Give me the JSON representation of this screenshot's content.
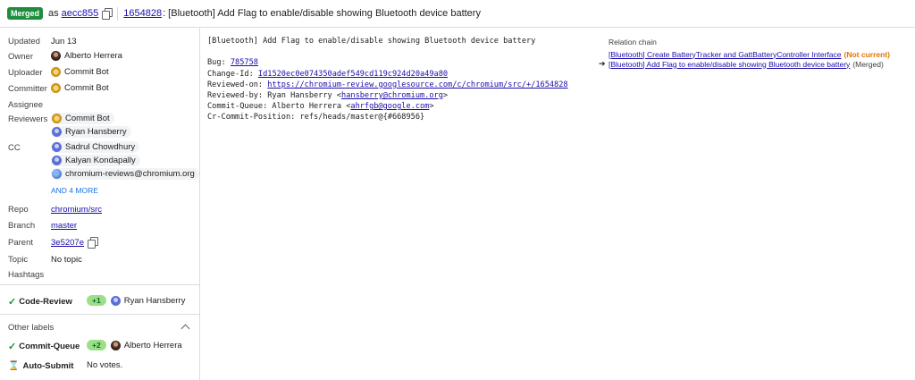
{
  "header": {
    "status_badge": "Merged",
    "as_text": "as",
    "commit_hash": "aecc855",
    "change_number": "1654828",
    "change_title": ": [Bluetooth] Add Flag to enable/disable showing Bluetooth device battery"
  },
  "sidebar": {
    "updated": {
      "label": "Updated",
      "value": "Jun 13"
    },
    "owner": {
      "label": "Owner",
      "name": "Alberto Herrera"
    },
    "uploader": {
      "label": "Uploader",
      "name": "Commit Bot"
    },
    "committer": {
      "label": "Committer",
      "name": "Commit Bot"
    },
    "assignee": {
      "label": "Assignee"
    },
    "reviewers": {
      "label": "Reviewers",
      "items": [
        "Commit Bot",
        "Ryan Hansberry"
      ]
    },
    "cc": {
      "label": "CC",
      "items": [
        "Sadrul Chowdhury",
        "Kalyan Kondapally",
        "chromium-reviews@chromium.org"
      ],
      "more": "AND 4 MORE"
    },
    "repo": {
      "label": "Repo",
      "value": "chromium/src"
    },
    "branch": {
      "label": "Branch",
      "value": "master"
    },
    "parent": {
      "label": "Parent",
      "value": "3e5207e"
    },
    "topic": {
      "label": "Topic",
      "value": "No topic"
    },
    "hashtags": {
      "label": "Hashtags"
    }
  },
  "labels": {
    "code_review": {
      "label": "Code-Review",
      "vote": "+1",
      "voter": "Ryan Hansberry"
    },
    "other_labels_title": "Other labels",
    "commit_queue": {
      "label": "Commit-Queue",
      "vote": "+2",
      "voter": "Alberto Herrera"
    },
    "auto_submit": {
      "label": "Auto-Submit",
      "value": "No votes."
    }
  },
  "commit_message": {
    "title": "[Bluetooth] Add Flag to enable/disable showing Bluetooth device battery",
    "bug_label": "Bug: ",
    "bug": "785758",
    "change_id_label": "Change-Id: ",
    "change_id": "Id1520ec0e074350adef549cd119c924d20a49a80",
    "reviewed_on_label": "Reviewed-on: ",
    "reviewed_on": "https://chromium-review.googlesource.com/c/chromium/src/+/1654828",
    "reviewed_by_prefix": "Reviewed-by: Ryan Hansberry <",
    "reviewed_by_email": "hansberry@chromium.org",
    "reviewed_by_suffix": ">",
    "commit_queue_prefix": "Commit-Queue: Alberto Herrera <",
    "commit_queue_email": "ahrfgb@google.com",
    "commit_queue_suffix": ">",
    "cr_commit_position": "Cr-Commit-Position: refs/heads/master@{#668956}"
  },
  "relation_chain": {
    "title": "Relation chain",
    "items": [
      {
        "text": "[Bluetooth] Create BatteryTracker and GattBatteryController Interface",
        "tag": "(Not current)"
      },
      {
        "text": "[Bluetooth] Add Flag to enable/disable showing Bluetooth device battery",
        "tag": "(Merged)"
      }
    ]
  },
  "colors": {
    "merged": "#1e8e3e",
    "link": "#1a0dab",
    "not_current": "#e37400",
    "vote": "#9be087"
  }
}
